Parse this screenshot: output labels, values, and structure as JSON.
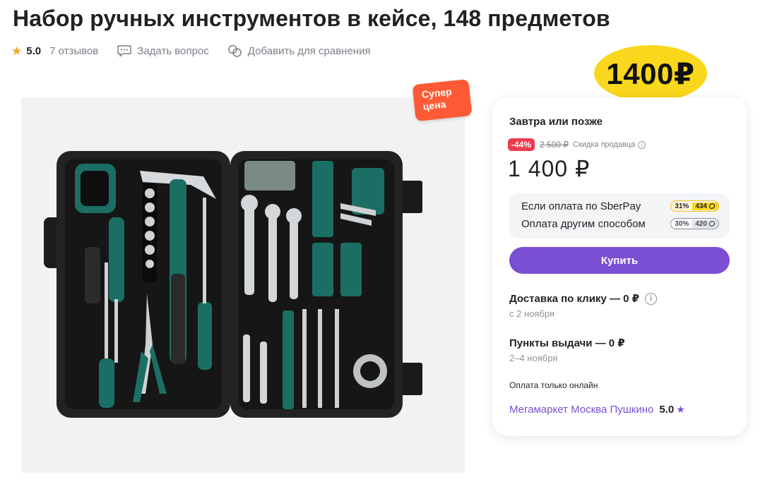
{
  "product": {
    "title": "Набор ручных инструментов в кейсе, 148 предметов",
    "rating": "5.0",
    "reviews": "7 отзывов",
    "ask_question": "Задать вопрос",
    "add_compare": "Добавить для сравнения"
  },
  "price_badge": "1400₽",
  "image": {
    "super_tag_line1": "Супер",
    "super_tag_line2": "цена"
  },
  "card": {
    "delivery_time": "Завтра или позже",
    "discount": "-44%",
    "old_price": "2 500 ₽",
    "seller_discount": "Скидка продавца",
    "price": "1 400 ₽",
    "payment": [
      {
        "label": "Если оплата по SberPay",
        "percent": "31%",
        "points": "434"
      },
      {
        "label": "Оплата другим способом",
        "percent": "30%",
        "points": "420"
      }
    ],
    "buy_label": "Купить",
    "delivery_click": "Доставка по клику — 0 ₽",
    "delivery_click_date": "с 2 ноября",
    "pickup": "Пункты выдачи — 0 ₽",
    "pickup_date": "2–4 ноября",
    "online_only": "Оплата только онлайн",
    "seller": "Мегамаркет Москва Пушкино",
    "seller_rating": "5.0"
  },
  "colors": {
    "accent": "#7b4fd4",
    "discount": "#ec3b4e",
    "badge": "#f9d71c",
    "rating_star": "#f5a623",
    "super_tag": "#ff5a36",
    "case_teal": "#1b6e63"
  },
  "icons": [
    "star-icon",
    "question-chat-icon",
    "compare-icon",
    "info-icon",
    "coin-icon"
  ]
}
